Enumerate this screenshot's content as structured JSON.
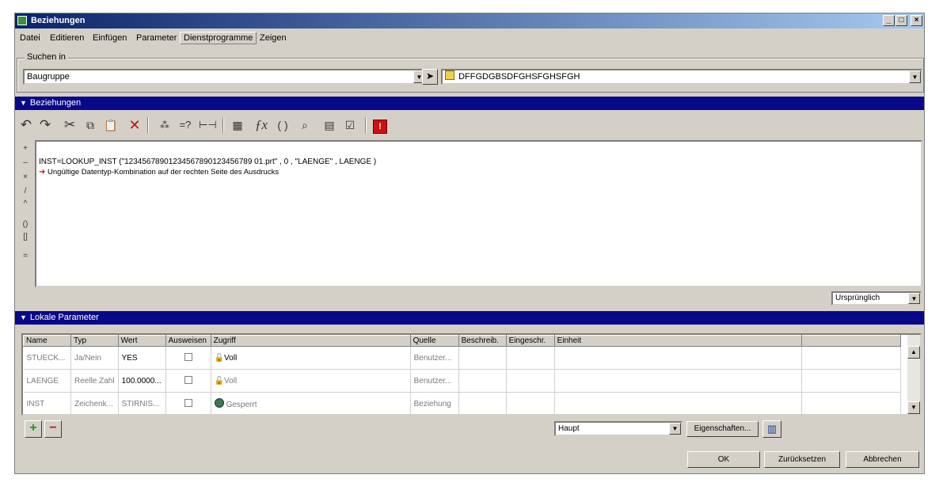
{
  "window": {
    "title": "Beziehungen"
  },
  "menu": [
    "Datei",
    "Editieren",
    "Einfügen",
    "Parameter",
    "Dienstprogramme",
    "Zeigen"
  ],
  "search": {
    "group_label": "Suchen in",
    "scope_value": "Baugruppe",
    "model_value": "DFFGDGBSDFGHSFGHSFGH"
  },
  "relations": {
    "header": "Beziehungen",
    "expression": "INST=LOOKUP_INST (\"12345678901234567890123456789 01.prt\" , 0 , \"LAENGE\" , LAENGE )",
    "error": "Ungültige Datentyp-Kombination auf der rechten Seite des Ausdrucks",
    "unit_mode": "Ursprünglich",
    "operators": [
      "+",
      "–",
      "×",
      "/",
      "^",
      "()",
      "[]",
      "="
    ]
  },
  "local_params": {
    "header": "Lokale Parameter",
    "columns": [
      "Name",
      "Typ",
      "Wert",
      "Ausweisen",
      "Zugriff",
      "Quelle",
      "Beschreib.",
      "Eingeschr.",
      "Einheit"
    ],
    "rows": [
      {
        "name": "STUECK...",
        "typ": "Ja/Nein",
        "wert": "YES",
        "zugriff": "Voll",
        "quelle": "Benutzer..."
      },
      {
        "name": "LAENGE",
        "typ": "Reelle Zahl",
        "wert": "100.0000...",
        "zugriff": "Voll",
        "quelle": "Benutzer..."
      },
      {
        "name": "INST",
        "typ": "Zeichenk...",
        "wert": "STIRNIS...",
        "zugriff": "Gesperrt",
        "quelle": "Beziehung"
      }
    ],
    "filter_value": "Haupt",
    "properties_label": "Eigenschaften..."
  },
  "buttons": {
    "ok": "OK",
    "reset": "Zurücksetzen",
    "cancel": "Abbrechen"
  },
  "colors": {
    "section_blue": "#08088a",
    "add_green": "#1a9a1a",
    "remove_red": "#c81010",
    "error_red": "#d01010"
  }
}
